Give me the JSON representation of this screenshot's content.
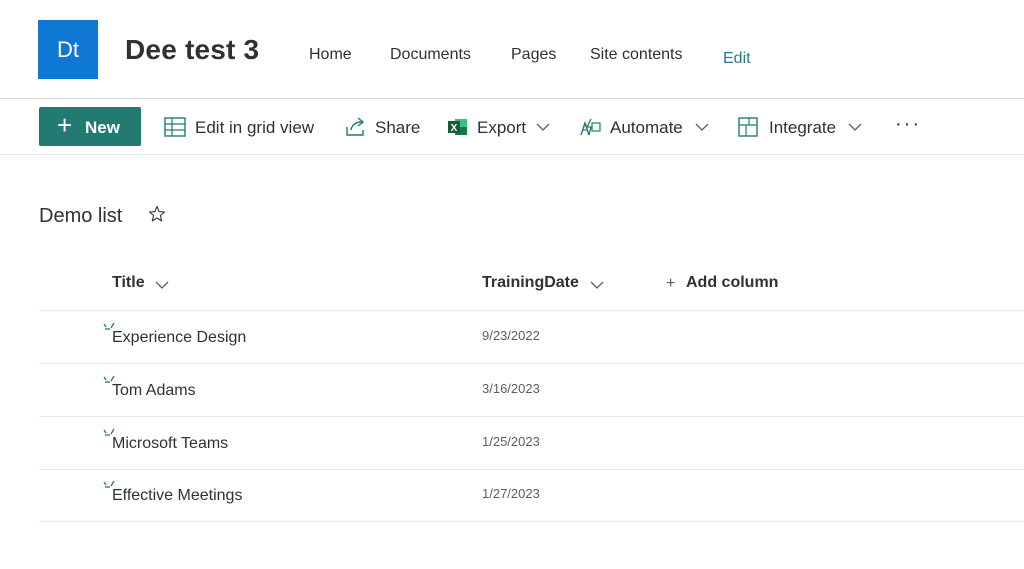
{
  "site": {
    "logo_text": "Dt",
    "title": "Dee test 3",
    "colors": {
      "logo_bg": "#0f78d4",
      "accent": "#227a72"
    }
  },
  "nav": {
    "home": "Home",
    "documents": "Documents",
    "pages": "Pages",
    "site_contents": "Site contents",
    "edit": "Edit"
  },
  "command_bar": {
    "new": "New",
    "edit_grid": "Edit in grid view",
    "share": "Share",
    "export": "Export",
    "automate": "Automate",
    "integrate": "Integrate",
    "more": "···"
  },
  "list": {
    "title": "Demo list",
    "columns": {
      "title": "Title",
      "training_date": "TrainingDate",
      "add_column": "Add column"
    },
    "rows": [
      {
        "title": "Experience Design",
        "date": "9/23/2022"
      },
      {
        "title": "Tom Adams",
        "date": "3/16/2023"
      },
      {
        "title": "Microsoft Teams",
        "date": "1/25/2023"
      },
      {
        "title": "Effective Meetings",
        "date": "1/27/2023"
      }
    ]
  }
}
